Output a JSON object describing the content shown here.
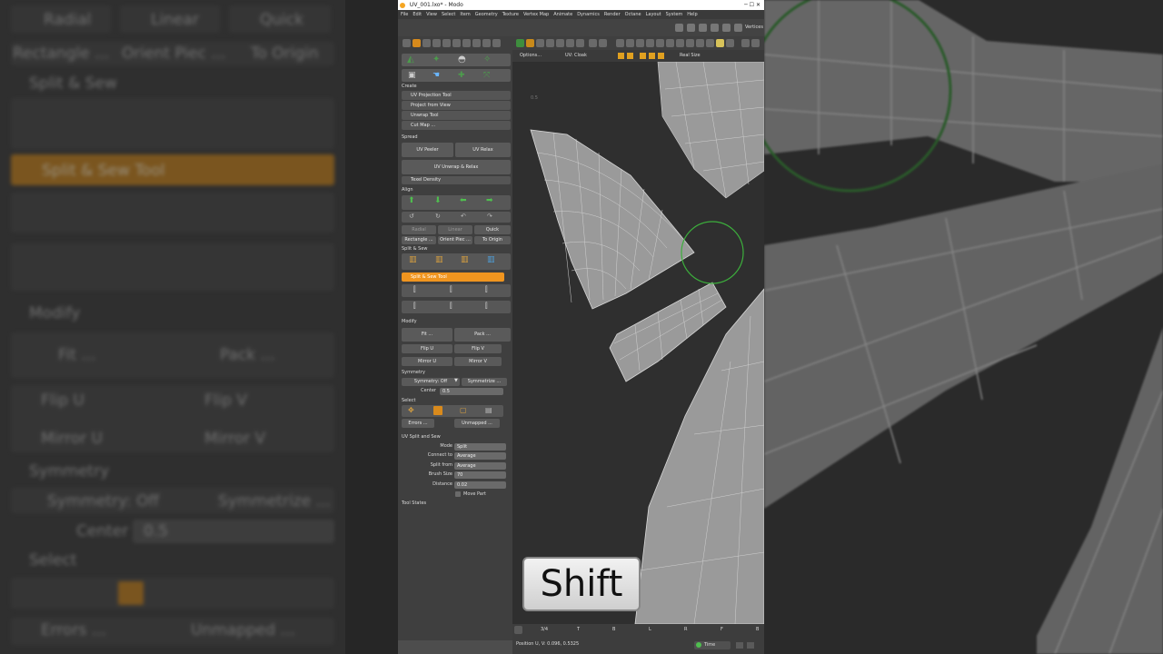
{
  "window": {
    "title": "UV_001.lxo* - Modo",
    "menu": [
      "File",
      "Edit",
      "View",
      "Select",
      "Item",
      "Geometry",
      "Texture",
      "Vertex Map",
      "Animate",
      "Dynamics",
      "Render",
      "Octane",
      "Layout",
      "System",
      "Help"
    ],
    "vertices_label": "Vertices"
  },
  "panel": {
    "sections": {
      "create": "Create",
      "spread": "Spread",
      "align": "Align",
      "split_sew": "Split & Sew",
      "modify": "Modify",
      "symmetry": "Symmetry",
      "select": "Select",
      "uv_split_sew": "UV Split and Sew",
      "tool_states": "Tool States"
    },
    "create_items": [
      "UV Projection Tool",
      "Project from View",
      "Unwrap Tool",
      "Cut Map ..."
    ],
    "spread": {
      "uv_peeler": "UV Peeler",
      "uv_relax": "UV Relax",
      "uv_unwrap_relax": "UV Unwrap & Relax",
      "texel_density": "Texel Density"
    },
    "align_modes": {
      "radial": "Radial",
      "linear": "Linear",
      "quick": "Quick"
    },
    "align_actions": {
      "rectangle": "Rectangle ...",
      "orient_piece": "Orient Piec ...",
      "to_origin": "To Origin"
    },
    "split_sew_tool": "Split & Sew Tool",
    "modify": {
      "fit": "Fit ...",
      "pack": "Pack ...",
      "flip_u": "Flip U",
      "flip_v": "Flip V",
      "mirror_u": "Mirror U",
      "mirror_v": "Mirror V"
    },
    "symmetry": {
      "state": "Symmetry: Off",
      "symmetrize": "Symmetrize ...",
      "center_label": "Center",
      "center_value": "0.5"
    },
    "select": {
      "errors": "Errors ...",
      "unmapped": "Unmapped ..."
    },
    "tool_props": {
      "mode_label": "Mode",
      "mode_value": "Split",
      "connect_label": "Connect to",
      "connect_value": "Average",
      "split_from_label": "Split from",
      "split_from_value": "Average",
      "brush_label": "Brush Size",
      "brush_value": "70",
      "distance_label": "Distance",
      "distance_value": "0.02",
      "move_part_label": "Move Part"
    }
  },
  "viewport": {
    "options": "Options...",
    "uv_map": "UV: Cloak",
    "real_size": "Real Size"
  },
  "status": {
    "tabs": [
      "3/4",
      "T",
      "B",
      "L",
      "R",
      "F",
      "B"
    ],
    "position": "Position U, V:  0.096, 0.5325",
    "time": "Time"
  },
  "key_overlay": "Shift",
  "colors": {
    "accent": "#f5a623",
    "panel_bg": "#3f3f3f",
    "viewport_bg": "#2f2f2f",
    "mesh_fill": "#9a9a9a",
    "brush": "#2e8b2e"
  },
  "background_echo": {
    "align_modes": [
      "Radial",
      "Linear",
      "Quick"
    ],
    "align_actions": [
      "Rectangle ...",
      "Orient Piec ...",
      "To Origin"
    ],
    "split_sew": "Split & Sew",
    "split_sew_tool": "Split & Sew Tool",
    "modify": "Modify",
    "fit": "Fit ...",
    "pack": "Pack ...",
    "flip_u": "Flip U",
    "flip_v": "Flip V",
    "mirror_u": "Mirror U",
    "mirror_v": "Mirror V",
    "symmetry": "Symmetry",
    "symmetry_off": "Symmetry: Off",
    "symmetrize": "Symmetrize ...",
    "center": "Center",
    "center_value": "0.5",
    "select": "Select",
    "errors": "Errors ...",
    "unmapped": "Unmapped ..."
  }
}
